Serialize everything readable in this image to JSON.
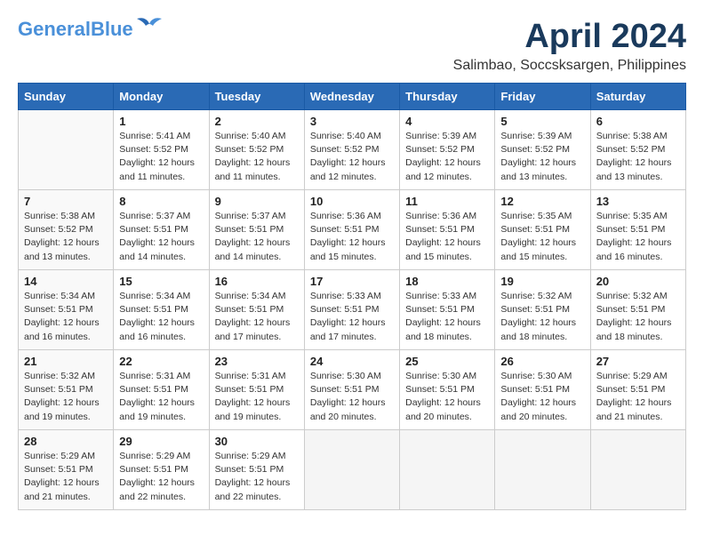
{
  "header": {
    "logo_general": "General",
    "logo_blue": "Blue",
    "month": "April 2024",
    "location": "Salimbao, Soccsksargen, Philippines"
  },
  "weekdays": [
    "Sunday",
    "Monday",
    "Tuesday",
    "Wednesday",
    "Thursday",
    "Friday",
    "Saturday"
  ],
  "weeks": [
    [
      {
        "day": "",
        "info": ""
      },
      {
        "day": "1",
        "info": "Sunrise: 5:41 AM\nSunset: 5:52 PM\nDaylight: 12 hours\nand 11 minutes."
      },
      {
        "day": "2",
        "info": "Sunrise: 5:40 AM\nSunset: 5:52 PM\nDaylight: 12 hours\nand 11 minutes."
      },
      {
        "day": "3",
        "info": "Sunrise: 5:40 AM\nSunset: 5:52 PM\nDaylight: 12 hours\nand 12 minutes."
      },
      {
        "day": "4",
        "info": "Sunrise: 5:39 AM\nSunset: 5:52 PM\nDaylight: 12 hours\nand 12 minutes."
      },
      {
        "day": "5",
        "info": "Sunrise: 5:39 AM\nSunset: 5:52 PM\nDaylight: 12 hours\nand 13 minutes."
      },
      {
        "day": "6",
        "info": "Sunrise: 5:38 AM\nSunset: 5:52 PM\nDaylight: 12 hours\nand 13 minutes."
      }
    ],
    [
      {
        "day": "7",
        "info": "Sunrise: 5:38 AM\nSunset: 5:52 PM\nDaylight: 12 hours\nand 13 minutes."
      },
      {
        "day": "8",
        "info": "Sunrise: 5:37 AM\nSunset: 5:51 PM\nDaylight: 12 hours\nand 14 minutes."
      },
      {
        "day": "9",
        "info": "Sunrise: 5:37 AM\nSunset: 5:51 PM\nDaylight: 12 hours\nand 14 minutes."
      },
      {
        "day": "10",
        "info": "Sunrise: 5:36 AM\nSunset: 5:51 PM\nDaylight: 12 hours\nand 15 minutes."
      },
      {
        "day": "11",
        "info": "Sunrise: 5:36 AM\nSunset: 5:51 PM\nDaylight: 12 hours\nand 15 minutes."
      },
      {
        "day": "12",
        "info": "Sunrise: 5:35 AM\nSunset: 5:51 PM\nDaylight: 12 hours\nand 15 minutes."
      },
      {
        "day": "13",
        "info": "Sunrise: 5:35 AM\nSunset: 5:51 PM\nDaylight: 12 hours\nand 16 minutes."
      }
    ],
    [
      {
        "day": "14",
        "info": "Sunrise: 5:34 AM\nSunset: 5:51 PM\nDaylight: 12 hours\nand 16 minutes."
      },
      {
        "day": "15",
        "info": "Sunrise: 5:34 AM\nSunset: 5:51 PM\nDaylight: 12 hours\nand 16 minutes."
      },
      {
        "day": "16",
        "info": "Sunrise: 5:34 AM\nSunset: 5:51 PM\nDaylight: 12 hours\nand 17 minutes."
      },
      {
        "day": "17",
        "info": "Sunrise: 5:33 AM\nSunset: 5:51 PM\nDaylight: 12 hours\nand 17 minutes."
      },
      {
        "day": "18",
        "info": "Sunrise: 5:33 AM\nSunset: 5:51 PM\nDaylight: 12 hours\nand 18 minutes."
      },
      {
        "day": "19",
        "info": "Sunrise: 5:32 AM\nSunset: 5:51 PM\nDaylight: 12 hours\nand 18 minutes."
      },
      {
        "day": "20",
        "info": "Sunrise: 5:32 AM\nSunset: 5:51 PM\nDaylight: 12 hours\nand 18 minutes."
      }
    ],
    [
      {
        "day": "21",
        "info": "Sunrise: 5:32 AM\nSunset: 5:51 PM\nDaylight: 12 hours\nand 19 minutes."
      },
      {
        "day": "22",
        "info": "Sunrise: 5:31 AM\nSunset: 5:51 PM\nDaylight: 12 hours\nand 19 minutes."
      },
      {
        "day": "23",
        "info": "Sunrise: 5:31 AM\nSunset: 5:51 PM\nDaylight: 12 hours\nand 19 minutes."
      },
      {
        "day": "24",
        "info": "Sunrise: 5:30 AM\nSunset: 5:51 PM\nDaylight: 12 hours\nand 20 minutes."
      },
      {
        "day": "25",
        "info": "Sunrise: 5:30 AM\nSunset: 5:51 PM\nDaylight: 12 hours\nand 20 minutes."
      },
      {
        "day": "26",
        "info": "Sunrise: 5:30 AM\nSunset: 5:51 PM\nDaylight: 12 hours\nand 20 minutes."
      },
      {
        "day": "27",
        "info": "Sunrise: 5:29 AM\nSunset: 5:51 PM\nDaylight: 12 hours\nand 21 minutes."
      }
    ],
    [
      {
        "day": "28",
        "info": "Sunrise: 5:29 AM\nSunset: 5:51 PM\nDaylight: 12 hours\nand 21 minutes."
      },
      {
        "day": "29",
        "info": "Sunrise: 5:29 AM\nSunset: 5:51 PM\nDaylight: 12 hours\nand 22 minutes."
      },
      {
        "day": "30",
        "info": "Sunrise: 5:29 AM\nSunset: 5:51 PM\nDaylight: 12 hours\nand 22 minutes."
      },
      {
        "day": "",
        "info": ""
      },
      {
        "day": "",
        "info": ""
      },
      {
        "day": "",
        "info": ""
      },
      {
        "day": "",
        "info": ""
      }
    ]
  ]
}
